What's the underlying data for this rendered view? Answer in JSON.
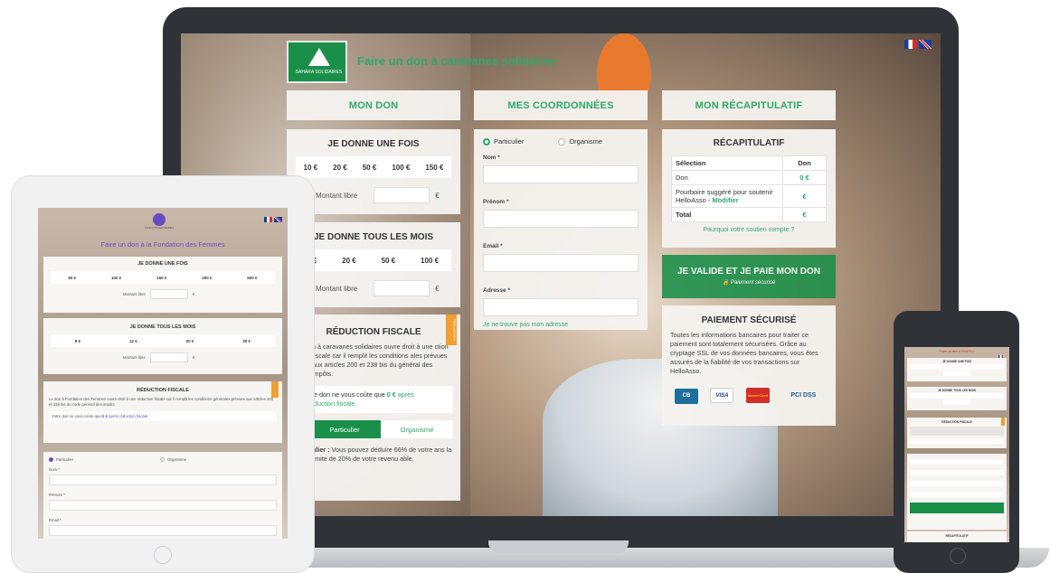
{
  "laptop": {
    "brand_title": "Faire un don à caravanes solidaires",
    "logo_text": "SAHARA SOLIDAIRES",
    "columns": {
      "don": {
        "header": "MON DON",
        "once": {
          "title": "JE DONNE UNE FOIS",
          "amounts": [
            "10 €",
            "20 €",
            "50 €",
            "100 €",
            "150 €"
          ],
          "free_label": "Montant libre",
          "currency": "€"
        },
        "monthly": {
          "title": "JE DONNE TOUS LES MOIS",
          "amounts": [
            ") €",
            "20 €",
            "50 €",
            "100 €"
          ],
          "free_label": "Montant libre",
          "currency": "€"
        },
        "tax": {
          "title": "RÉDUCTION FISCALE",
          "ribbon": "REDUCTION",
          "text": "n à caravanes solidaires ouvre droit à une ction fiscale car il remplit les conditions ales prévues aux articles 200 et 238 bis du général des impôts.",
          "cost_prefix": "e don ne vous coûte que",
          "cost_value": "0 €",
          "cost_suffix_1": "après",
          "cost_suffix_2": "duction fiscale.",
          "tab_particulier": "Particulier",
          "tab_organisme": "Organisme",
          "note_bold": "ulier :",
          "note": "Vous pouvez déduire 66% de votre ans la limite de 20% de votre revenu able."
        }
      },
      "coordonnees": {
        "header": "MES COORDONNÉES",
        "radio_particulier": "Particulier",
        "radio_organisme": "Organisme",
        "fields": [
          "Nom *",
          "Prénom *",
          "Email *",
          "Adresse *"
        ],
        "address_link": "Je ne trouve pas mon adresse"
      },
      "recap": {
        "header": "MON RÉCAPITULATIF",
        "title": "RÉCAPITULATIF",
        "table_head": [
          "Sélection",
          "Don"
        ],
        "rows": [
          {
            "label": "Don",
            "value": "0 €"
          },
          {
            "label": "Pourboire suggéré pour soutenir HelloAsso -",
            "link": "Modifier",
            "value": "€"
          },
          {
            "label": "Total",
            "value": "€"
          }
        ],
        "why_link": "Pourquoi votre soutien compte ?",
        "validate_button": "JE VALIDE ET JE PAIE MON DON",
        "secure_sub": "Paiement sécurisé",
        "secure_title": "PAIEMENT SÉCURISÉ",
        "secure_text": "Toutes les informations bancaires pour traiter ce paiement sont totalement sécurisées. Grâce au cryptage SSL de vos données bancaires, vous êtes assurés de la fiabilité de vos transactions sur HelloAsso.",
        "cards": [
          "CB",
          "VISA",
          "MasterCard",
          "PCI DSS"
        ]
      }
    }
  },
  "tablet": {
    "title": "Faire un don à la Fondation des Femmes",
    "logo_text": "FONDATION DES FEMMES",
    "once_title": "JE DONNE UNE FOIS",
    "once_amounts": [
      "50 €",
      "100 €",
      "150 €",
      "200 €",
      "500 €"
    ],
    "free_label": "Montant libre",
    "currency": "€",
    "monthly_title": "JE DONNE TOUS LES MOIS",
    "monthly_amounts": [
      "8 €",
      "12 €",
      "20 €",
      "30 €"
    ],
    "tax_title": "RÉDUCTION FISCALE",
    "tax_text": "Le don à Fondation des Femmes ouvre droit à une réduction fiscale car il remplit les conditions générales prévues aux articles 200 et 238 bis du code général des impôts.",
    "cost_text": "Votre don ne vous coûte que",
    "cost_value": "0 €",
    "cost_suffix": "après réduction fiscale.",
    "radio_particulier": "Particulier",
    "radio_organisme": "Organisme",
    "fields": [
      "Nom *",
      "Prénom *",
      "Email *"
    ]
  },
  "phone": {
    "title": "Faire un don à FRATELI",
    "once_title": "JE DONNE UNE FOIS",
    "monthly_title": "JE DONNE TOUS LES MOIS",
    "tax_title": "RÉDUCTION FISCALE",
    "recap_title": "RÉCAPITULATIF"
  },
  "colors": {
    "accent": "#2ea86b",
    "button": "#1a8f4a",
    "laptop_frame": "#2f3338"
  }
}
